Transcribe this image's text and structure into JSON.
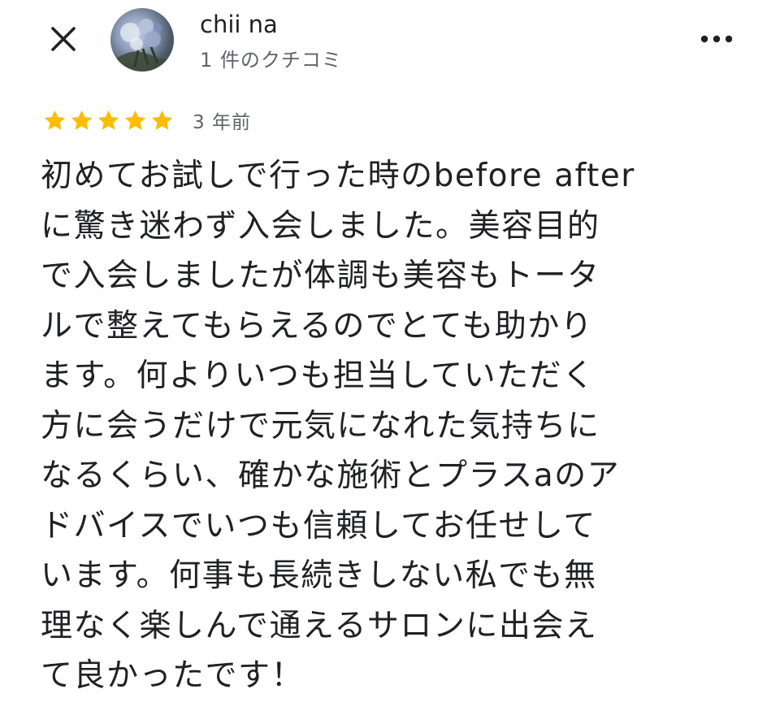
{
  "header": {
    "close_icon": "close-icon",
    "avatar_icon": "avatar",
    "user_name": "chii na",
    "review_count": "1 件のクチコミ",
    "more_icon": "more-horizontal-icon"
  },
  "review": {
    "rating": 5,
    "rating_max": 5,
    "star_color": "#fbbc04",
    "date": "3 年前",
    "lines": [
      "初めてお試しで行った時のbefore after",
      "に驚き迷わず入会しました。美容目的",
      "で入会しましたが体調も美容もトータ",
      "ルで整えてもらえるのでとても助かり",
      "ます。何よりいつも担当していただく",
      "方に会うだけで元気になれた気持ちに",
      "なるくらい、確かな施術とプラスaのア",
      "ドバイスでいつも信頼してお任せして",
      "います。何事も長続きしない私でも無",
      "理なく楽しんで通えるサロンに出会え",
      "て良かったです！"
    ]
  }
}
